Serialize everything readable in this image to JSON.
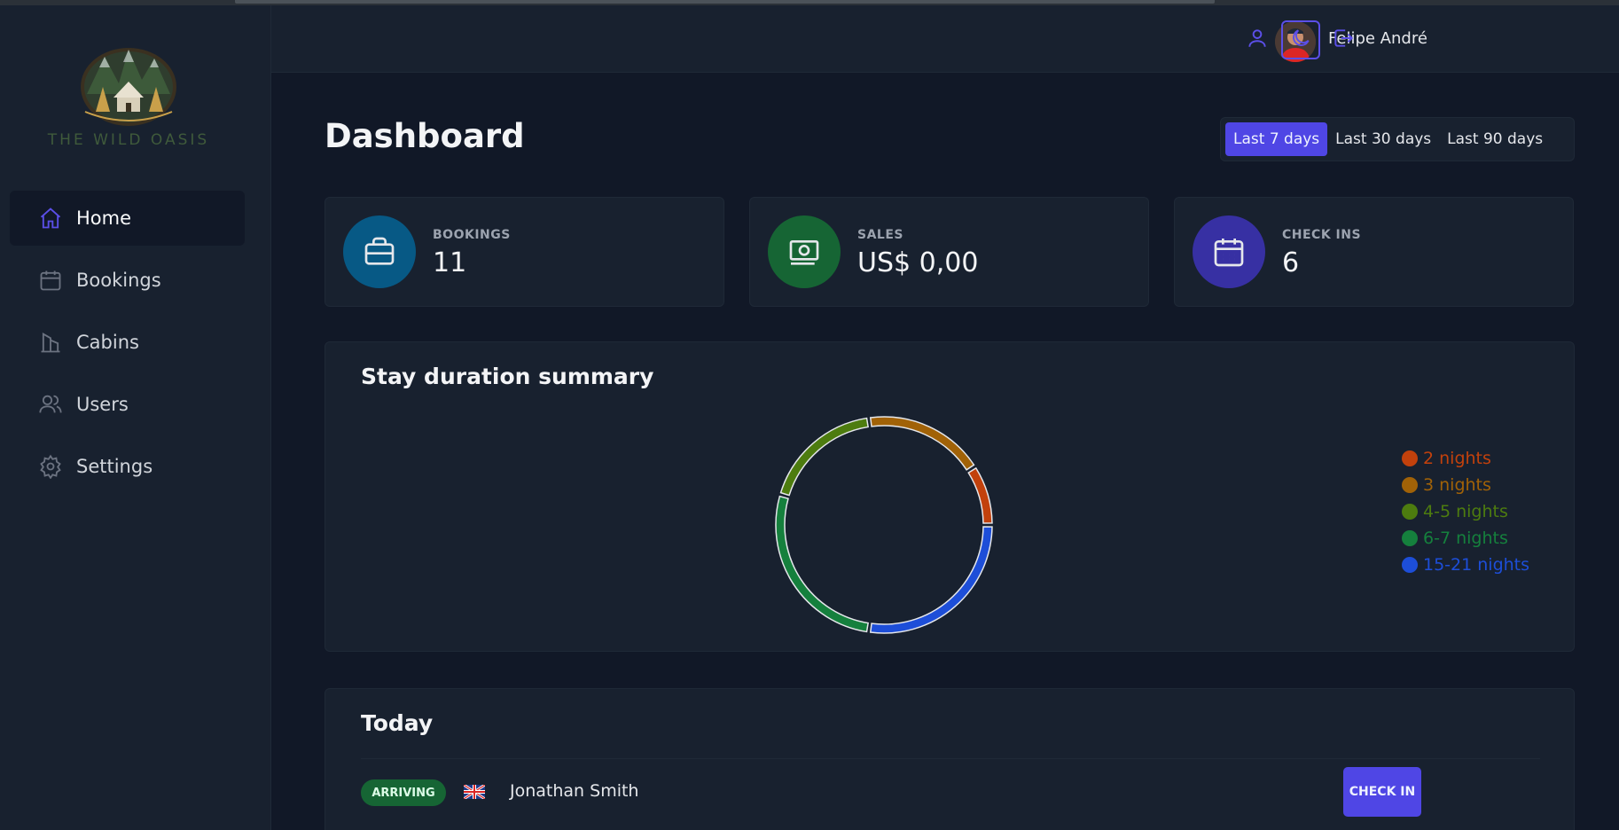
{
  "app": {
    "brand": "THE WILD OASIS"
  },
  "sidebar": {
    "items": [
      {
        "label": "Home",
        "icon": "home-icon",
        "active": true
      },
      {
        "label": "Bookings",
        "icon": "calendar-icon",
        "active": false
      },
      {
        "label": "Cabins",
        "icon": "building-icon",
        "active": false
      },
      {
        "label": "Users",
        "icon": "users-icon",
        "active": false
      },
      {
        "label": "Settings",
        "icon": "gear-icon",
        "active": false
      }
    ]
  },
  "header": {
    "user_name": "Felipe André",
    "buttons": [
      {
        "icon": "user-icon"
      },
      {
        "icon": "moon-icon"
      },
      {
        "icon": "logout-icon"
      }
    ]
  },
  "dashboard": {
    "title": "Dashboard",
    "filters": [
      "Last 7 days",
      "Last 30 days",
      "Last 90 days"
    ],
    "active_filter": "Last 7 days",
    "stats": [
      {
        "label": "BOOKINGS",
        "value": "11",
        "icon": "briefcase-icon",
        "color": "#075985"
      },
      {
        "label": "SALES",
        "value": "US$ 0,00",
        "icon": "banknotes-icon",
        "color": "#166534"
      },
      {
        "label": "CHECK INS",
        "value": "6",
        "icon": "calendar-days-icon",
        "color": "#3730a3"
      }
    ]
  },
  "stay_summary": {
    "title": "Stay duration summary"
  },
  "chart_data": {
    "type": "pie",
    "title": "Stay duration summary",
    "categories": [
      "2 nights",
      "3 nights",
      "4-5 nights",
      "6-7 nights",
      "15-21 nights"
    ],
    "values": [
      1,
      2,
      2,
      3,
      3
    ],
    "colors": [
      "#c2410c",
      "#a16207",
      "#4d7c0f",
      "#15803d",
      "#1d4ed8"
    ],
    "legend": "right"
  },
  "today": {
    "title": "Today",
    "activities": [
      {
        "status": "ARRIVING",
        "guest": "Jonathan Smith",
        "action": "CHECK IN"
      }
    ]
  }
}
